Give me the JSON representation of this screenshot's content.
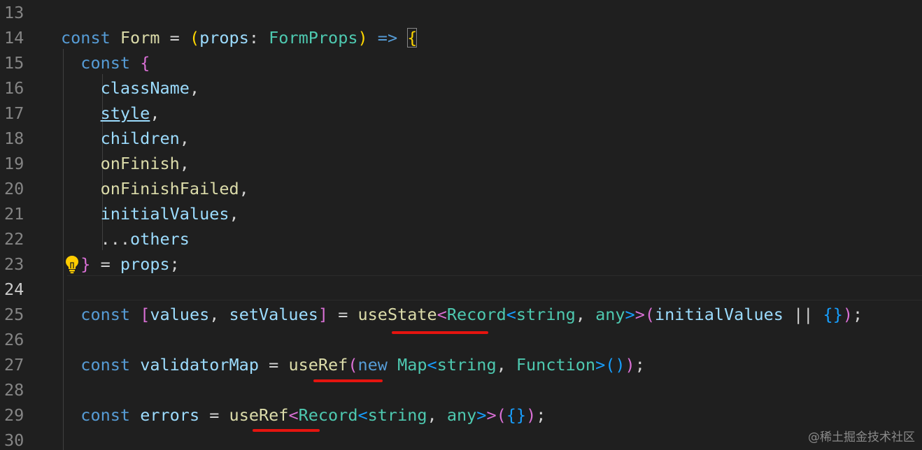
{
  "editor": {
    "line_numbers": [
      "13",
      "14",
      "15",
      "16",
      "17",
      "18",
      "19",
      "20",
      "21",
      "22",
      "23",
      "24",
      "25",
      "26",
      "27",
      "28",
      "29",
      "30"
    ],
    "tokens": {
      "const": "const",
      "form": "Form",
      "eq": " = ",
      "props": "props",
      "colon": ": ",
      "formprops": "FormProps",
      "arrow": " => ",
      "lparen": "(",
      "rparen": ")",
      "lbrace": "{",
      "rbrace": "}",
      "lbracket": "[",
      "rbracket": "]",
      "className": "className",
      "style": "style",
      "children": "children",
      "onFinish": "onFinish",
      "onFinishFailed": "onFinishFailed",
      "initialValues": "initialValues",
      "spread": "...",
      "others": "others",
      "comma": ",",
      "comma_sp": ", ",
      "semi": ";",
      "values": "values",
      "setValues": "setValues",
      "useState": "useState",
      "lt": "<",
      "gt": ">",
      "gtgt": ">>",
      "Record": "Record",
      "string": "string",
      "any": "any",
      "or": " || ",
      "validatorMap": "validatorMap",
      "useRef": "useRef",
      "new": "new",
      "Map": "Map",
      "Function": "Function",
      "errors": "errors"
    }
  },
  "colors": {
    "background": "#1f1f1f",
    "keyword": "#569cd6",
    "variable": "#9cdcfe",
    "function": "#dcdcaa",
    "type": "#4ec9b0",
    "bracket_gold": "#ffd700",
    "bracket_pink": "#da70d6",
    "bracket_blue": "#179fff",
    "annotation_red": "#e5140f"
  },
  "icons": {
    "lightbulb": "lightbulb-icon"
  },
  "watermark": "@稀土掘金技术社区"
}
